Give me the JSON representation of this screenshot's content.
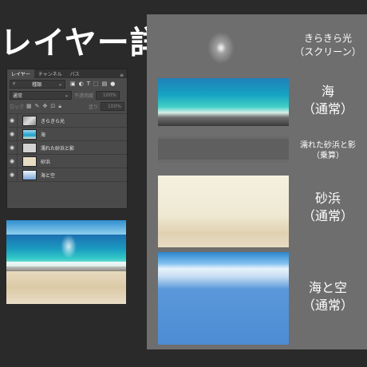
{
  "title": "レイヤー詳細",
  "panel": {
    "tabs": [
      {
        "label": "レイヤー",
        "active": true
      },
      {
        "label": "チャンネル",
        "active": false
      },
      {
        "label": "パス",
        "active": false
      }
    ],
    "menu_icon": "menu-icon",
    "kind_filter": "種類",
    "blend_mode": "通常",
    "opacity_label": "不透明度",
    "opacity_value": "100%",
    "lock_label": "ロック",
    "fill_label": "塗り",
    "fill_value": "100%",
    "layers": [
      {
        "name": "きらきら光",
        "thumb": "gray-gradient"
      },
      {
        "name": "海",
        "thumb": "sea"
      },
      {
        "name": "濡れた砂浜と影",
        "thumb": "light-gray"
      },
      {
        "name": "砂浜",
        "thumb": "sand"
      },
      {
        "name": "海と空",
        "thumb": "sky"
      }
    ]
  },
  "labels": [
    {
      "main": "きらきら光",
      "sub": "（スクリーン）"
    },
    {
      "main": "海",
      "sub": "（通常）"
    },
    {
      "main": "濡れた砂浜と影",
      "sub": "（乗算）"
    },
    {
      "main": "砂浜",
      "sub": "（通常）"
    },
    {
      "main": "海と空",
      "sub": "（通常）"
    }
  ],
  "colors": {
    "background": "#2a2a2a",
    "panel": "#4a4a4a",
    "right_area": "#6e6e6e",
    "sea": "#16a4c3",
    "sky": "#4d8bd3",
    "sand": "#efe9d3"
  }
}
